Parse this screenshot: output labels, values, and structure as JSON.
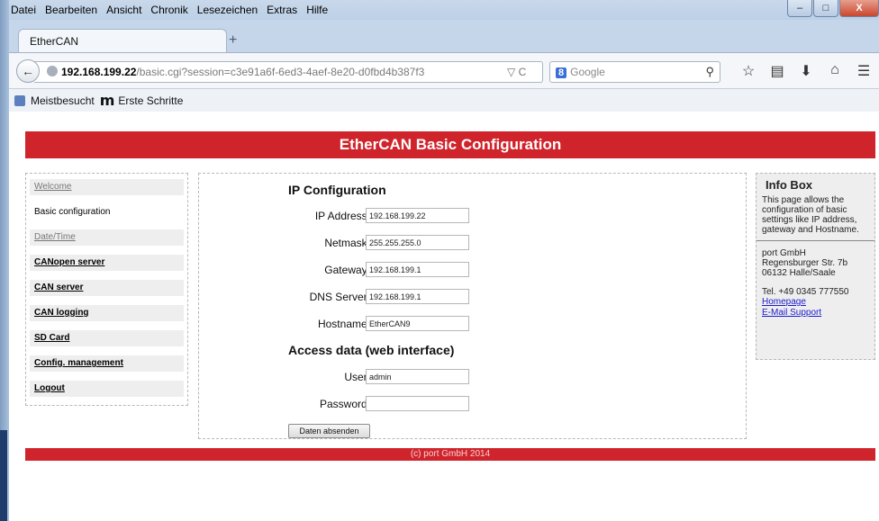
{
  "browser": {
    "menu": [
      "Datei",
      "Bearbeiten",
      "Ansicht",
      "Chronik",
      "Lesezeichen",
      "Extras",
      "Hilfe"
    ],
    "window_controls": {
      "minimize": "–",
      "maximize": "□",
      "close": "X"
    },
    "tab_title": "EtherCAN",
    "new_tab": "+",
    "url_host": "192.168.199.22",
    "url_path": "/basic.cgi?session=c3e91a6f-6ed3-4aef-8e20-d0fbd4b387f3",
    "url_tools": "▽ C",
    "search_placeholder": "Google",
    "search_engine": "8",
    "bookmarks": [
      "Meistbesucht",
      "Erste Schritte"
    ]
  },
  "page": {
    "header": "EtherCAN Basic Configuration",
    "sidebar": [
      {
        "label": "Welcome",
        "state": "inactive"
      },
      {
        "label": "Basic configuration",
        "state": "active"
      },
      {
        "label": "Date/Time",
        "state": "inactive"
      },
      {
        "label": "CANopen server",
        "state": "link"
      },
      {
        "label": "CAN server",
        "state": "link"
      },
      {
        "label": "CAN logging",
        "state": "link"
      },
      {
        "label": "SD Card",
        "state": "link"
      },
      {
        "label": "Config. management",
        "state": "link"
      },
      {
        "label": "Logout",
        "state": "link"
      }
    ],
    "ip_section": {
      "title": "IP Configuration",
      "fields": [
        {
          "label": "IP Address:",
          "value": "192.168.199.22"
        },
        {
          "label": "Netmask:",
          "value": "255.255.255.0"
        },
        {
          "label": "Gateway:",
          "value": "192.168.199.1"
        },
        {
          "label": "DNS Server:",
          "value": "192.168.199.1"
        },
        {
          "label": "Hostname:",
          "value": "EtherCAN9"
        }
      ]
    },
    "access_section": {
      "title": "Access data (web interface)",
      "user_label": "User:",
      "user_value": "admin",
      "password_label": "Password:",
      "password_value": ""
    },
    "submit_label": "Daten absenden",
    "infobox": {
      "title": "Info Box",
      "text": "This page allows the configuration of basic settings like IP address, gateway and Hostname.",
      "company": "port GmbH",
      "street": "Regensburger Str. 7b",
      "city": "06132 Halle/Saale",
      "phone": "Tel. +49 0345 777550",
      "homepage": "Homepage",
      "email": "E-Mail Support"
    },
    "footer": "(c) port GmbH 2014"
  },
  "colors": {
    "brand_red": "#d0242c",
    "sidebar_bg": "#eeeeee",
    "link_blue": "#1a1acc"
  }
}
